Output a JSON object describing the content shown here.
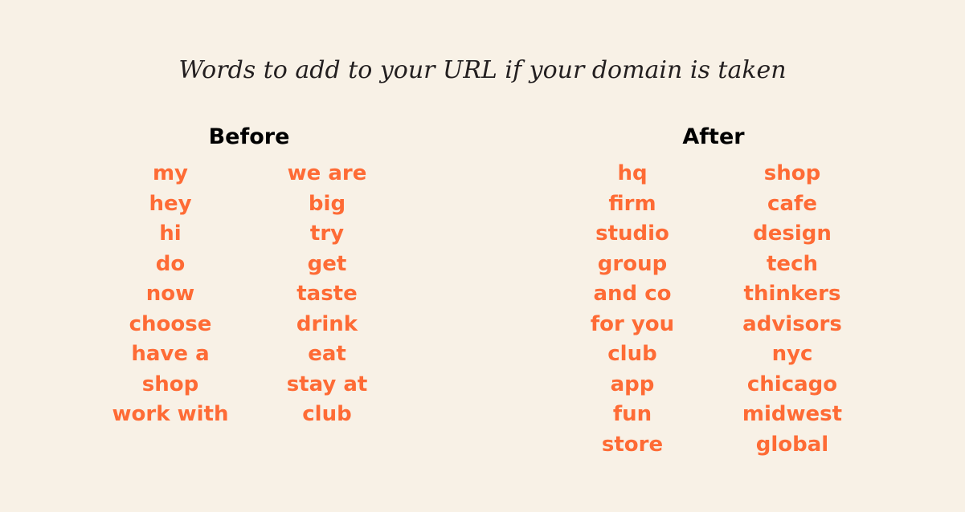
{
  "title": "Words to add to your URL if your domain is taken",
  "accent_color": "#fe6b35",
  "before": {
    "heading": "Before",
    "columns": [
      [
        "my",
        "hey",
        "hi",
        "do",
        "now",
        "choose",
        "have a",
        "shop",
        "work with"
      ],
      [
        "we are",
        "big",
        "try",
        "get",
        "taste",
        "drink",
        "eat",
        "stay at",
        "club"
      ]
    ]
  },
  "after": {
    "heading": "After",
    "columns": [
      [
        "hq",
        "firm",
        "studio",
        "group",
        "and co",
        "for you",
        "club",
        "app",
        "fun",
        "store"
      ],
      [
        "shop",
        "cafe",
        "design",
        "tech",
        "thinkers",
        "advisors",
        "nyc",
        "chicago",
        "midwest",
        "global"
      ]
    ]
  }
}
